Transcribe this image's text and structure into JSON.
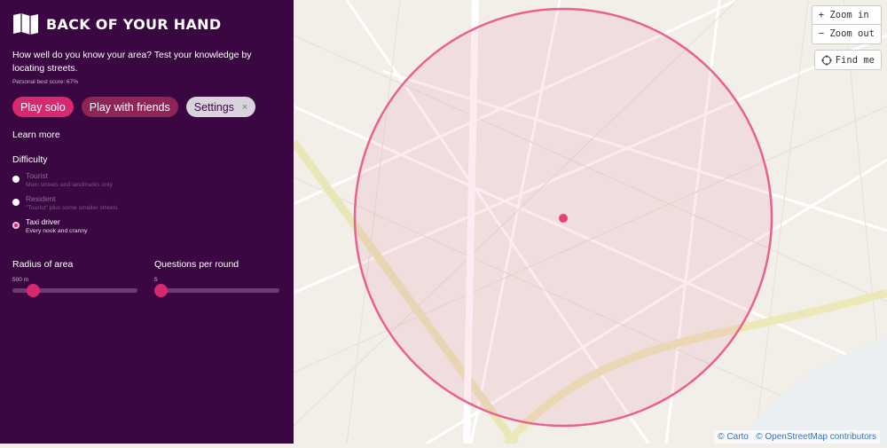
{
  "app": {
    "title": "BACK OF YOUR HAND",
    "intro": "How well do you know your area? Test your knowledge by locating streets.",
    "best_score": "Personal best score: 67%"
  },
  "buttons": {
    "solo": "Play solo",
    "friends": "Play with friends",
    "settings": "Settings",
    "settings_close": "×",
    "learn_more": "Learn more"
  },
  "difficulty": {
    "heading": "Difficulty",
    "options": [
      {
        "label": "Tourist",
        "desc": "Main streets and landmarks only",
        "selected": false
      },
      {
        "label": "Resident",
        "desc": "\"Tourist\" plus some smaller streets",
        "selected": false
      },
      {
        "label": "Taxi driver",
        "desc": "Every nook and cranny",
        "selected": true
      }
    ]
  },
  "radius": {
    "label": "Radius of area",
    "value": "500 m",
    "fraction": 0.05
  },
  "questions": {
    "label": "Questions per round",
    "value": "5",
    "fraction": 0.0
  },
  "map": {
    "zoom_in": "+ Zoom in",
    "zoom_out": "− Zoom out",
    "find_me": "Find me",
    "attr_carto": "© Carto",
    "attr_osm": "© OpenStreetMap contributors",
    "circle_color": "#e8628f"
  }
}
